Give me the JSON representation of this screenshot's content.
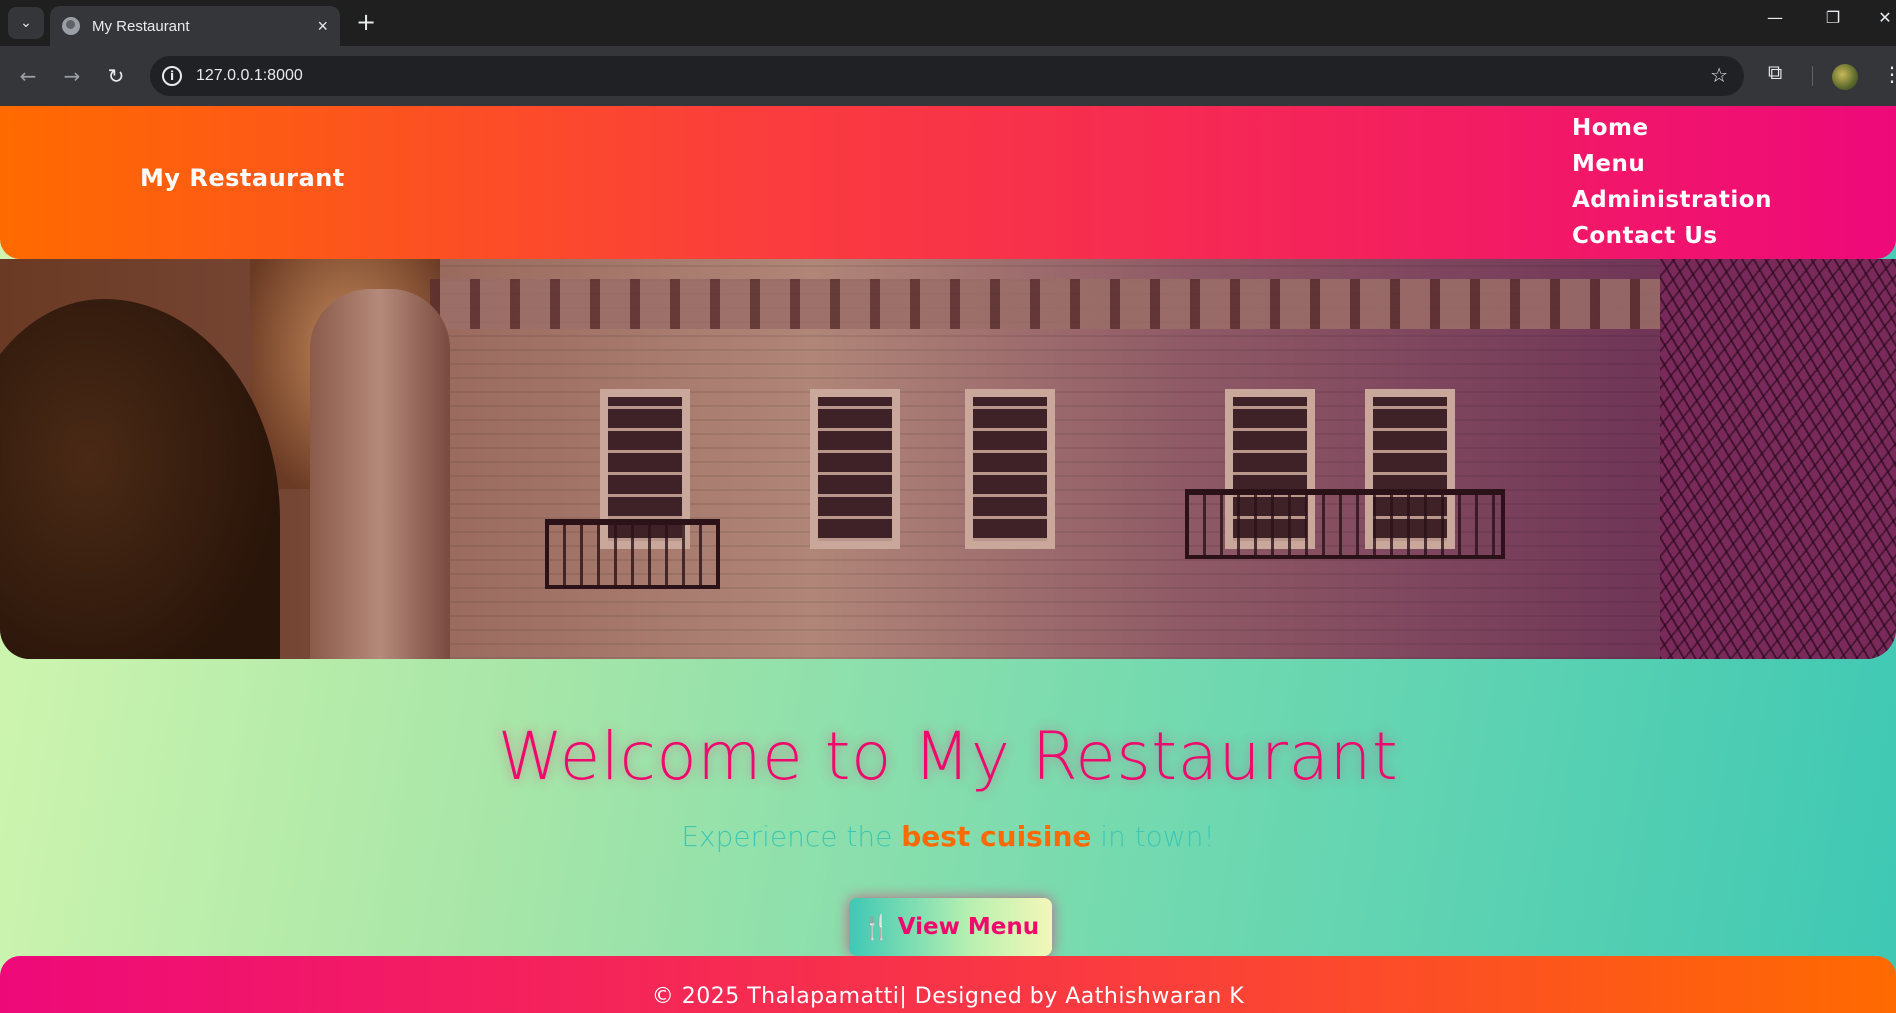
{
  "browser": {
    "tab_title": "My Restaurant",
    "new_tab_symbol": "+",
    "url": "127.0.0.1:8000"
  },
  "site": {
    "brand": "My Restaurant",
    "nav": [
      "Home",
      "Menu",
      "Administration",
      "Contact Us"
    ]
  },
  "hero": {
    "title": "Welcome to My Restaurant",
    "tagline_prefix": "Experience the ",
    "tagline_highlight": "best cuisine",
    "tagline_suffix": " in town!",
    "cta_label": "View Menu",
    "cta_icon": "fork-knife-icon"
  },
  "footer": {
    "text": "© 2025 Thalapamatti| Designed by Aathishwaran K"
  },
  "colors": {
    "header_start": "#ff6a00",
    "header_end": "#ee0979",
    "title": "#ee0a6c",
    "highlight": "#ff6a00",
    "tagline": "#3ec8b4"
  }
}
